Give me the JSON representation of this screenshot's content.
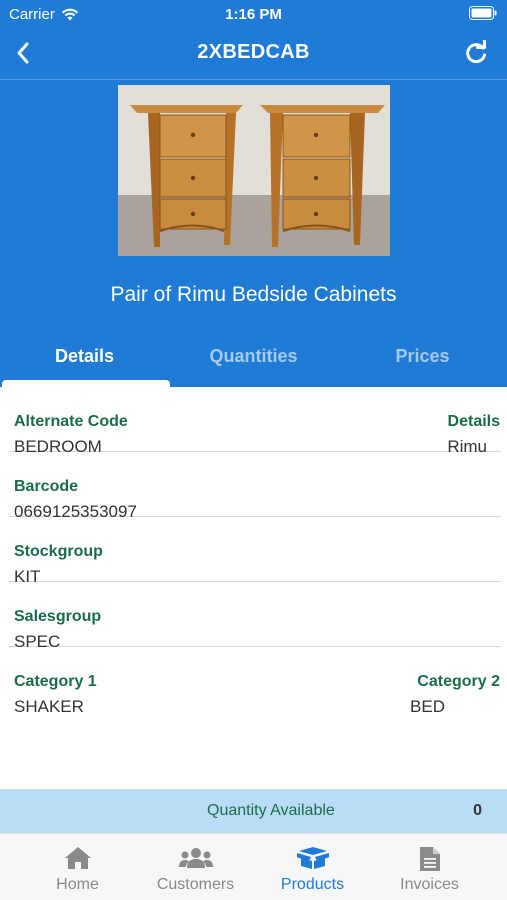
{
  "status_bar": {
    "carrier": "Carrier",
    "time": "1:16 PM"
  },
  "nav": {
    "title": "2XBEDCAB"
  },
  "product": {
    "name": "Pair of Rimu Bedside Cabinets"
  },
  "tabs": [
    {
      "label": "Details",
      "active": true
    },
    {
      "label": "Quantities",
      "active": false
    },
    {
      "label": "Prices",
      "active": false
    }
  ],
  "details": {
    "alternate_code": {
      "label": "Alternate Code",
      "value": "BEDROOM"
    },
    "details_field": {
      "label": "Details",
      "value": "Rimu"
    },
    "barcode": {
      "label": "Barcode",
      "value": "0669125353097"
    },
    "stockgroup": {
      "label": "Stockgroup",
      "value": "KIT"
    },
    "salesgroup": {
      "label": "Salesgroup",
      "value": "SPEC"
    },
    "category1": {
      "label": "Category 1",
      "value": "SHAKER"
    },
    "category2": {
      "label": "Category 2",
      "value": "BED"
    }
  },
  "quantity": {
    "label": "Quantity Available",
    "value": "0"
  },
  "tabbar": [
    {
      "label": "Home",
      "icon": "home-icon",
      "selected": false
    },
    {
      "label": "Customers",
      "icon": "users-icon",
      "selected": false
    },
    {
      "label": "Products",
      "icon": "box-icon",
      "selected": true
    },
    {
      "label": "Invoices",
      "icon": "document-icon",
      "selected": false
    }
  ],
  "colors": {
    "primary": "#1f7bd6",
    "label_green": "#1b6d4a",
    "quantity_bar": "#b9dcf7"
  }
}
